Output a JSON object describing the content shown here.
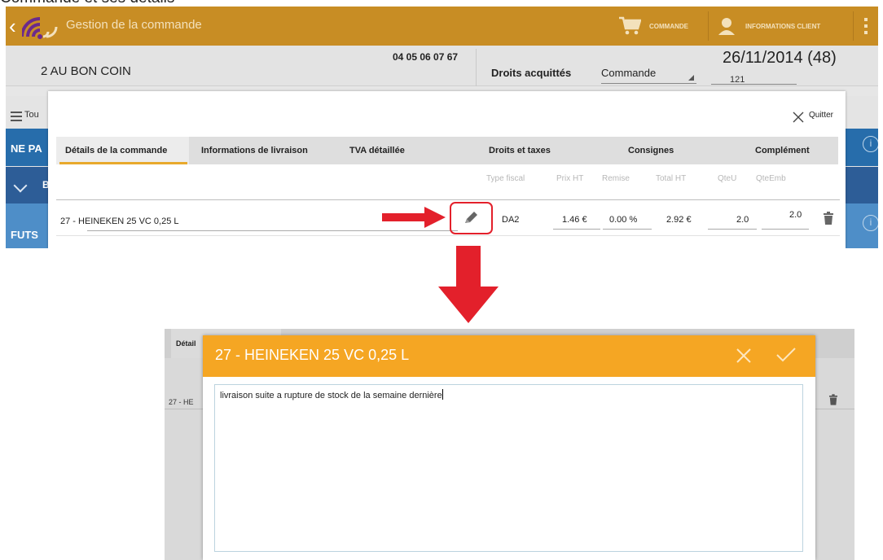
{
  "caption": "Commande et ses details",
  "app": {
    "title": "Gestion de la commande",
    "commande_label": "COMMANDE",
    "info_client_label": "INFORMATIONS CLIENT"
  },
  "header": {
    "client_name": "2  AU BON COIN",
    "phone": "04 05 06 07 67",
    "droits": "Droits acquittés",
    "commande_select": "Commande",
    "date": "26/11/2014 (48)",
    "sub_value": "121"
  },
  "background_rows": {
    "tout": "Tou",
    "nepa": "NE PA",
    "b": "B",
    "futs": "FUTS",
    "info_symbol": "i"
  },
  "dialog": {
    "quit_label": "Quitter",
    "tabs": [
      "Détails de la commande",
      "Informations de livraison",
      "TVA détaillée",
      "Droits et taxes",
      "Consignes",
      "Complément"
    ],
    "columns": [
      "Type fiscal",
      "Prix HT",
      "Remise",
      "Total HT",
      "QteU",
      "QteEmb"
    ],
    "row": {
      "product": "27 - HEINEKEN 25 VC   0,25 L",
      "type_fiscal": "DA2",
      "prix_ht": "1.46 €",
      "remise": "0.00 %",
      "total_ht": "2.92 €",
      "qteu": "2.0",
      "qteemb": "2.0"
    }
  },
  "shot2": {
    "tab_label": "Détail",
    "row_product": "27 - HE",
    "modal_title": "27 - HEINEKEN 25 VC   0,25 L",
    "comment_text": "livraison suite a rupture de stock de la semaine dernière"
  },
  "colors": {
    "app_bar": "#c88d24",
    "modal_header": "#f5a623",
    "highlight_red": "#e3202b",
    "tab_underline": "#e8a92c"
  },
  "icons": [
    "back-arrow-icon",
    "app-logo-icon",
    "cart-icon",
    "person-icon",
    "more-vert-icon",
    "list-icon",
    "chevron-down-icon",
    "info-icon",
    "close-icon",
    "pencil-icon",
    "trash-icon",
    "check-icon",
    "red-arrow-right-icon",
    "red-arrow-down-icon"
  ]
}
